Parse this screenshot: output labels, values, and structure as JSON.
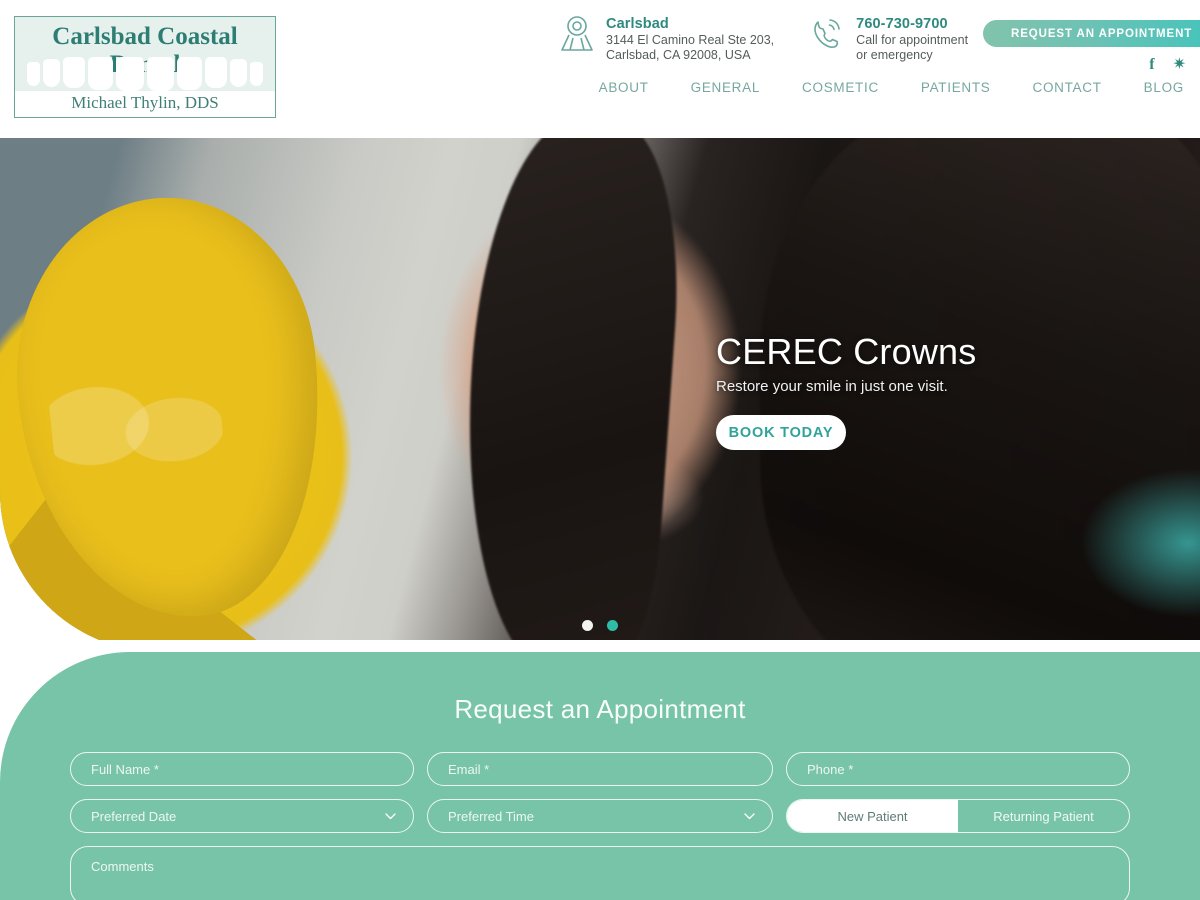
{
  "brand": {
    "logo_title": "Carlsbad Coastal Dental",
    "logo_subtitle": "Michael Thylin, DDS",
    "accent": "#2f8a7e",
    "section_green": "#78c4a8",
    "nav_color": "#76a8a0"
  },
  "header": {
    "location": {
      "icon": "map-pin-icon",
      "title": "Carlsbad",
      "line1": "3144 El Camino Real Ste 203,",
      "line2": "Carlsbad, CA 92008, USA"
    },
    "phone": {
      "icon": "phone-icon",
      "number": "760-730-9700",
      "line1": "Call for appointment",
      "line2": "or emergency"
    },
    "cta_label": "REQUEST AN APPOINTMENT",
    "social": [
      {
        "name": "facebook-icon",
        "glyph": "f"
      },
      {
        "name": "yelp-icon",
        "glyph": "✷"
      }
    ],
    "nav": [
      {
        "label": "ABOUT"
      },
      {
        "label": "GENERAL"
      },
      {
        "label": "COSMETIC"
      },
      {
        "label": "PATIENTS"
      },
      {
        "label": "CONTACT"
      },
      {
        "label": "BLOG"
      }
    ]
  },
  "hero": {
    "title": "CEREC Crowns",
    "subtitle": "Restore your smile in just one visit.",
    "button_label": "BOOK TODAY",
    "slides": [
      {
        "state": "inactive"
      },
      {
        "state": "active"
      }
    ]
  },
  "appointment": {
    "heading": "Request an Appointment",
    "fields": {
      "full_name": {
        "placeholder": "Full Name *",
        "value": ""
      },
      "email": {
        "placeholder": "Email *",
        "value": ""
      },
      "phone": {
        "placeholder": "Phone *",
        "value": ""
      },
      "preferred_date": {
        "placeholder": "Preferred Date",
        "value": ""
      },
      "preferred_time": {
        "placeholder": "Preferred Time",
        "value": ""
      },
      "comments": {
        "placeholder": "Comments",
        "value": ""
      }
    },
    "patient_toggle": {
      "new_label": "New Patient",
      "returning_label": "Returning Patient",
      "selected": "New Patient"
    }
  }
}
